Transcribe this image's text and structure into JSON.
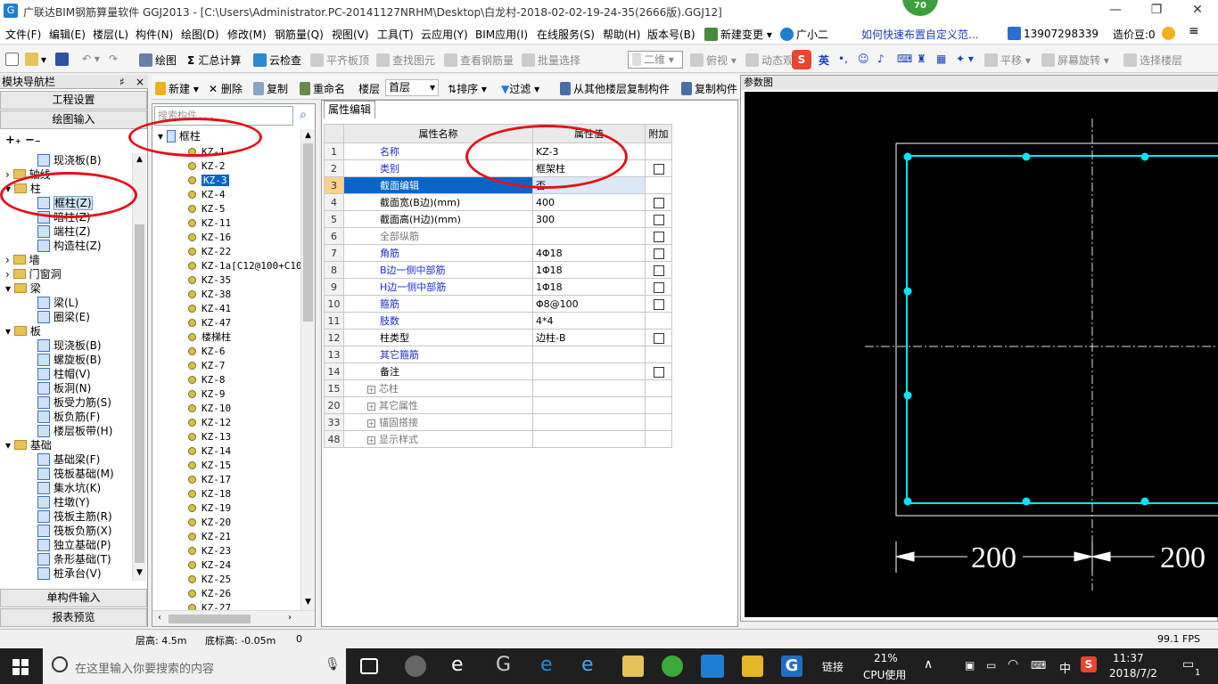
{
  "window": {
    "title": "广联达BIM钢筋算量软件 GGJ2013 - [C:\\Users\\Administrator.PC-20141127NRHM\\Desktop\\白龙村-2018-02-02-19-24-35(2666版).GGJ12]",
    "badge": "70"
  },
  "menu": [
    "文件(F)",
    "编辑(E)",
    "楼层(L)",
    "构件(N)",
    "绘图(D)",
    "修改(M)",
    "钢筋量(Q)",
    "视图(V)",
    "工具(T)",
    "云应用(Y)",
    "BIM应用(I)",
    "在线服务(S)",
    "帮助(H)",
    "版本号(B)",
    "新建变更",
    "广小二",
    "如何快速布置自定义范...",
    "13907298339",
    "造价豆:0"
  ],
  "toolbar": {
    "draw": "绘图",
    "sum": "汇总计算",
    "cloud_check": "云检查",
    "level_slab": "平齐板顶",
    "find_elem": "查找图元",
    "view_rebar": "查看钢筋量",
    "batch_select": "批量选择",
    "view2d": "二维",
    "top_view": "俯视",
    "dynamic": "动态观",
    "ime": "英",
    "pan": "平移",
    "rotate": "屏幕旋转",
    "select_floor": "选择楼层"
  },
  "comp_toolbar": {
    "new": "新建",
    "delete": "删除",
    "copy": "复制",
    "rename": "重命名",
    "floor_label": "楼层",
    "floor": "首层",
    "sort": "排序",
    "filter": "过滤",
    "copy_from": "从其他楼层复制构件",
    "copy_to": "复制构件"
  },
  "nav": {
    "header": "模块导航栏",
    "pin": "♯",
    "close": "×",
    "btn_project": "工程设置",
    "btn_draw": "绘图输入",
    "btn_single": "单构件输入",
    "btn_report": "报表预览",
    "tree": [
      {
        "label": "现浇板(B)",
        "level": 2,
        "type": "item"
      },
      {
        "label": "轴线",
        "level": 1,
        "type": "folder"
      },
      {
        "label": "柱",
        "level": 1,
        "type": "folder",
        "open": true
      },
      {
        "label": "框柱(Z)",
        "level": 2,
        "type": "item",
        "selected": true
      },
      {
        "label": "暗柱(Z)",
        "level": 2,
        "type": "item"
      },
      {
        "label": "端柱(Z)",
        "level": 2,
        "type": "item"
      },
      {
        "label": "构造柱(Z)",
        "level": 2,
        "type": "item"
      },
      {
        "label": "墙",
        "level": 1,
        "type": "folder"
      },
      {
        "label": "门窗洞",
        "level": 1,
        "type": "folder"
      },
      {
        "label": "梁",
        "level": 1,
        "type": "folder",
        "open": true
      },
      {
        "label": "梁(L)",
        "level": 2,
        "type": "item"
      },
      {
        "label": "圈梁(E)",
        "level": 2,
        "type": "item"
      },
      {
        "label": "板",
        "level": 1,
        "type": "folder",
        "open": true
      },
      {
        "label": "现浇板(B)",
        "level": 2,
        "type": "item"
      },
      {
        "label": "螺旋板(B)",
        "level": 2,
        "type": "item"
      },
      {
        "label": "柱帽(V)",
        "level": 2,
        "type": "item"
      },
      {
        "label": "板洞(N)",
        "level": 2,
        "type": "item"
      },
      {
        "label": "板受力筋(S)",
        "level": 2,
        "type": "item"
      },
      {
        "label": "板负筋(F)",
        "level": 2,
        "type": "item"
      },
      {
        "label": "楼层板带(H)",
        "level": 2,
        "type": "item"
      },
      {
        "label": "基础",
        "level": 1,
        "type": "folder",
        "open": true
      },
      {
        "label": "基础梁(F)",
        "level": 2,
        "type": "item"
      },
      {
        "label": "筏板基础(M)",
        "level": 2,
        "type": "item"
      },
      {
        "label": "集水坑(K)",
        "level": 2,
        "type": "item"
      },
      {
        "label": "柱墩(Y)",
        "level": 2,
        "type": "item"
      },
      {
        "label": "筏板主筋(R)",
        "level": 2,
        "type": "item"
      },
      {
        "label": "筏板负筋(X)",
        "level": 2,
        "type": "item"
      },
      {
        "label": "独立基础(P)",
        "level": 2,
        "type": "item"
      },
      {
        "label": "条形基础(T)",
        "level": 2,
        "type": "item"
      },
      {
        "label": "桩承台(V)",
        "level": 2,
        "type": "item"
      }
    ]
  },
  "components": {
    "search_placeholder": "搜索构件...",
    "root": "框柱",
    "items": [
      "KZ-1",
      "KZ-2",
      "KZ-3",
      "KZ-4",
      "KZ-5",
      "KZ-11",
      "KZ-16",
      "KZ-22",
      "KZ-1a[C12@100+C10",
      "KZ-35",
      "KZ-38",
      "KZ-41",
      "KZ-47",
      "楼梯柱",
      "KZ-6",
      "KZ-7",
      "KZ-8",
      "KZ-9",
      "KZ-10",
      "KZ-12",
      "KZ-13",
      "KZ-14",
      "KZ-15",
      "KZ-17",
      "KZ-18",
      "KZ-19",
      "KZ-20",
      "KZ-21",
      "KZ-23",
      "KZ-24",
      "KZ-25",
      "KZ-26",
      "KZ-27"
    ],
    "selected_index": 2
  },
  "props": {
    "tab": "属性编辑",
    "col_name": "属性名称",
    "col_value": "属性值",
    "col_extra": "附加",
    "rows": [
      {
        "n": "1",
        "name": "名称",
        "value": "KZ-3",
        "style": "blue",
        "chk": false
      },
      {
        "n": "2",
        "name": "类别",
        "value": "框架柱",
        "style": "blue",
        "chk": true
      },
      {
        "n": "3",
        "name": "截面编辑",
        "value": "否",
        "style": "sel",
        "chk": false
      },
      {
        "n": "4",
        "name": "截面宽(B边)(mm)",
        "value": "400",
        "style": "",
        "chk": true
      },
      {
        "n": "5",
        "name": "截面高(H边)(mm)",
        "value": "300",
        "style": "",
        "chk": true
      },
      {
        "n": "6",
        "name": "全部纵筋",
        "value": "",
        "style": "gray",
        "chk": true
      },
      {
        "n": "7",
        "name": "角筋",
        "value": "4Φ18",
        "style": "blue",
        "chk": true
      },
      {
        "n": "8",
        "name": "B边一侧中部筋",
        "value": "1Φ18",
        "style": "blue",
        "chk": true
      },
      {
        "n": "9",
        "name": "H边一侧中部筋",
        "value": "1Φ18",
        "style": "blue",
        "chk": true
      },
      {
        "n": "10",
        "name": "箍筋",
        "value": "Φ8@100",
        "style": "blue",
        "chk": true
      },
      {
        "n": "11",
        "name": "肢数",
        "value": "4*4",
        "style": "blue",
        "chk": false
      },
      {
        "n": "12",
        "name": "柱类型",
        "value": "边柱-B",
        "style": "",
        "chk": true
      },
      {
        "n": "13",
        "name": "其它箍筋",
        "value": "",
        "style": "blue",
        "chk": false
      },
      {
        "n": "14",
        "name": "备注",
        "value": "",
        "style": "",
        "chk": true
      },
      {
        "n": "15",
        "name": "芯柱",
        "value": "",
        "style": "group",
        "chk": false
      },
      {
        "n": "20",
        "name": "其它属性",
        "value": "",
        "style": "group",
        "chk": false
      },
      {
        "n": "33",
        "name": "锚固搭接",
        "value": "",
        "style": "group",
        "chk": false
      },
      {
        "n": "48",
        "name": "显示样式",
        "value": "",
        "style": "group",
        "chk": false
      }
    ]
  },
  "canvas": {
    "header": "参数图",
    "dim_left": "200",
    "dim_right": "200",
    "line_color": "#00e5ff"
  },
  "status": {
    "floor_height": "层高: 4.5m",
    "bottom_elev": "底标高: -0.05m",
    "zero": "0",
    "fps": "99.1 FPS"
  },
  "taskbar": {
    "search": "在这里输入你要搜索的内容",
    "link": "链接",
    "cpu_pct": "21%",
    "cpu_label": "CPU使用",
    "lang": "中",
    "time": "11:37",
    "date": "2018/7/2",
    "notif": "1"
  }
}
